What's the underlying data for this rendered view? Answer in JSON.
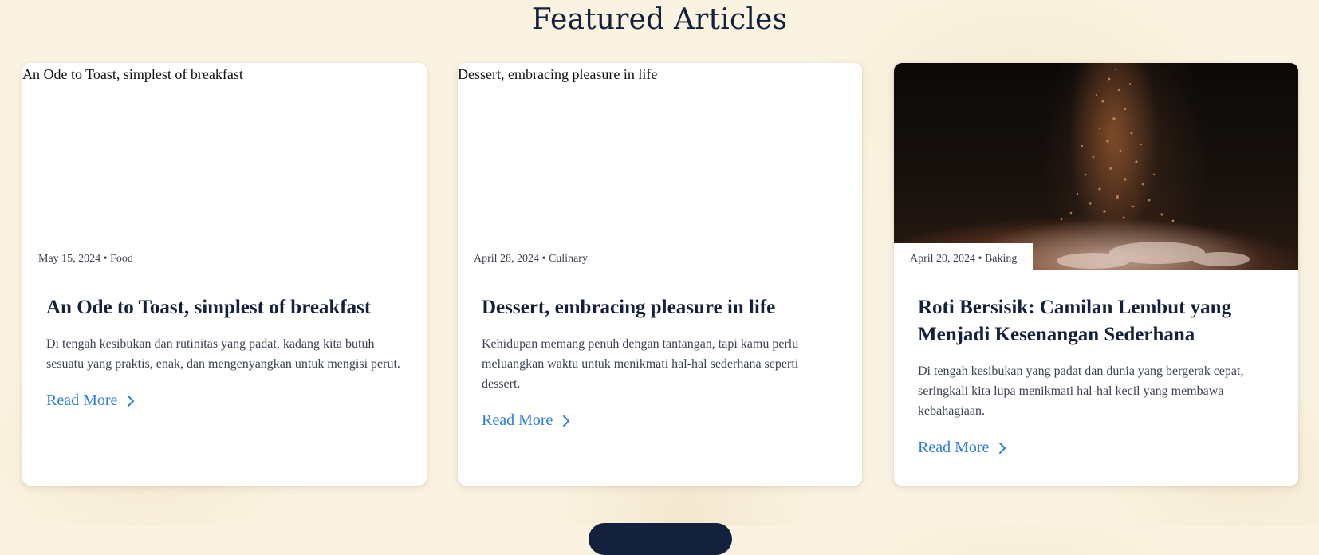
{
  "section": {
    "title": "Featured Articles"
  },
  "articles": [
    {
      "image_alt": "An Ode to Toast, simplest of breakfast",
      "meta": "May 15, 2024 • Food",
      "title": "An Ode to Toast, simplest of breakfast",
      "excerpt": "Di tengah kesibukan dan rutinitas yang padat, kadang kita butuh sesuatu yang praktis, enak, dan mengenyangkan untuk mengisi perut.",
      "cta": "Read More"
    },
    {
      "image_alt": "Dessert, embracing pleasure in life",
      "meta": "April 28, 2024 • Culinary",
      "title": "Dessert, embracing pleasure in life",
      "excerpt": "Kehidupan memang penuh dengan tantangan, tapi kamu perlu meluangkan waktu untuk menikmati hal-hal sederhana seperti dessert.",
      "cta": "Read More"
    },
    {
      "meta": "April 20, 2024 • Baking",
      "title": "Roti Bersisik: Camilan Lembut yang Menjadi Kesenangan Sederhana",
      "excerpt": "Di tengah kesibukan yang padat dan dunia yang bergerak cepat, seringkali kita lupa menikmati hal-hal kecil yang membawa kebahagiaan.",
      "cta": "Read More"
    }
  ],
  "icons": {
    "read_more": "chevron-right-icon"
  },
  "colors": {
    "link": "#2f7be0",
    "heading": "#13213c",
    "background": "#fbf3e2"
  }
}
